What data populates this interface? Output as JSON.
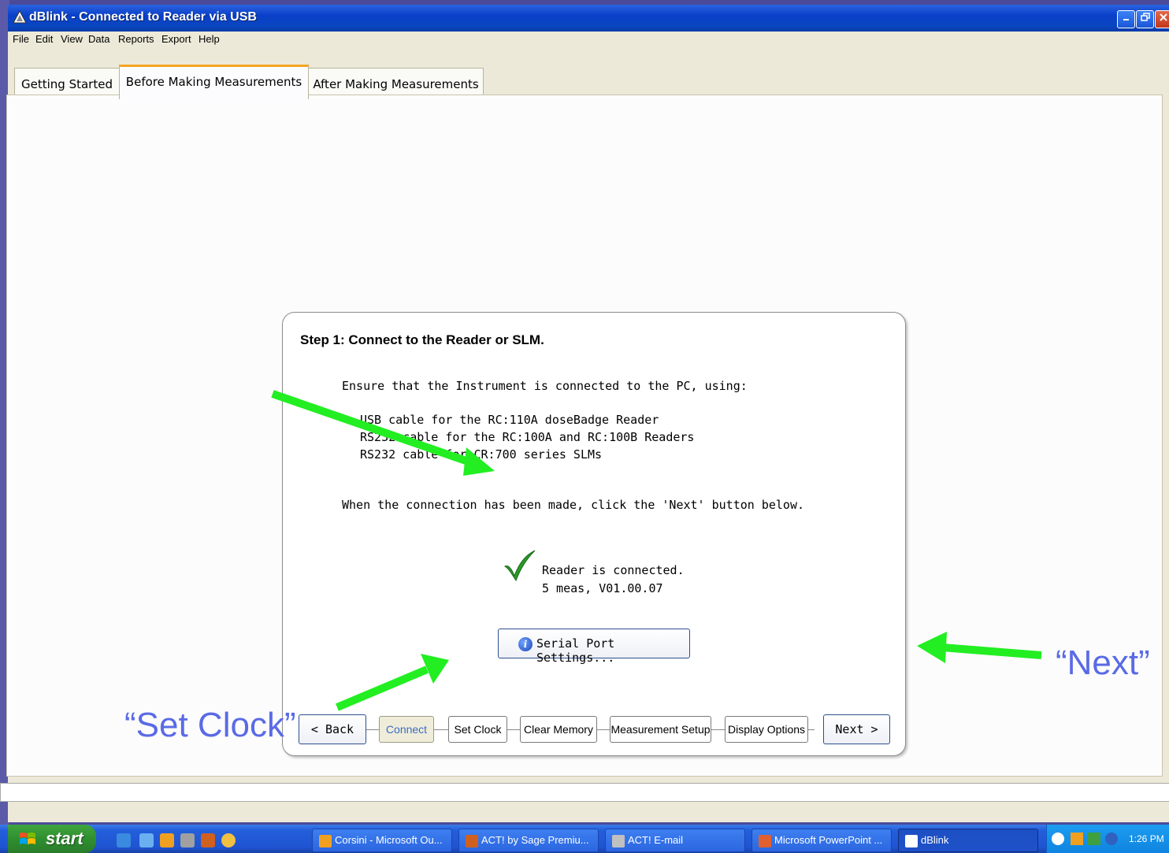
{
  "window": {
    "title": "dBlink - Connected to Reader via USB"
  },
  "menu": [
    "File",
    "Edit",
    "View",
    "Data",
    "Reports",
    "Export",
    "Help"
  ],
  "tabs": [
    "Getting Started",
    "Before Making Measurements",
    "After Making Measurements"
  ],
  "active_tab": "Before Making Measurements",
  "panel": {
    "step_title": "Step 1: Connect to the Reader or SLM.",
    "intro": "Ensure that the Instrument is connected to the PC, using:",
    "cables": [
      "USB cable for the RC:110A doseBadge Reader",
      "RS232 cable for the RC:100A and RC:100B Readers",
      "RS232 cable for CR:700 series SLMs"
    ],
    "instruction": "When the connection has been made, click the 'Next' button below.",
    "status_line1": "Reader is connected.",
    "status_line2": "5 meas, V01.00.07",
    "serial_button": "Serial Port Settings..."
  },
  "nav": {
    "back": "< Back",
    "steps": [
      "Connect",
      "Set Clock",
      "Clear Memory",
      "Measurement Setup",
      "Display Options"
    ],
    "current_step": "Connect",
    "next": "Next >"
  },
  "annotations": {
    "set_clock": "“Set Clock”",
    "next": "“Next”",
    "arrow_color": "#22ee22"
  },
  "taskbar": {
    "start": "start",
    "items": [
      {
        "label": "Corsini - Microsoft Ou...",
        "icon": "outlook-icon"
      },
      {
        "label": "ACT! by Sage Premiu...",
        "icon": "act-icon"
      },
      {
        "label": "ACT! E-mail",
        "icon": "email-icon"
      },
      {
        "label": "Microsoft PowerPoint ...",
        "icon": "powerpoint-icon"
      },
      {
        "label": "dBlink",
        "icon": "dblink-icon"
      }
    ],
    "active_item": "dBlink",
    "clock": "1:26 PM"
  }
}
